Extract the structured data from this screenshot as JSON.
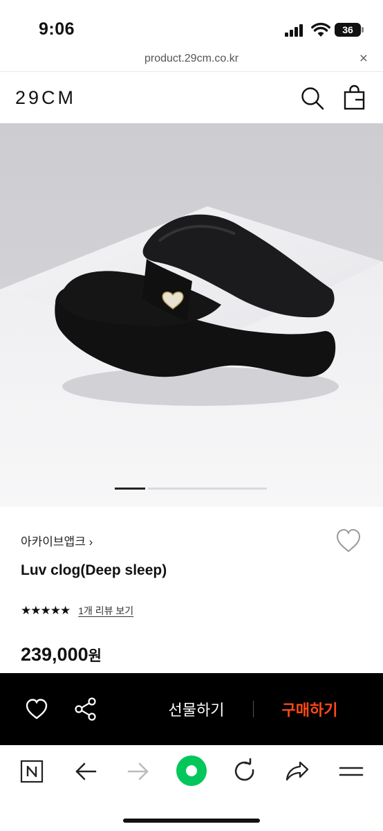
{
  "status_bar": {
    "time": "9:06",
    "battery": "36"
  },
  "url_bar": {
    "url": "product.29cm.co.kr",
    "close": "×"
  },
  "header": {
    "logo": "29CM"
  },
  "product": {
    "brand": "아카이브앱크 ›",
    "name": "Luv clog(Deep sleep)",
    "stars": "★★★★★",
    "rating": 5,
    "review_link": "1개 리뷰 보기",
    "price": "239,000",
    "price_unit": "원"
  },
  "carousel": {
    "current": 1
  },
  "action_bar": {
    "gift_label": "선물하기",
    "buy_label": "구매하기"
  },
  "colors": {
    "accent": "#ff4a17",
    "action_bar_bg": "#000000",
    "naver_green": "#03c75a"
  },
  "icons": [
    "search-icon",
    "bag-icon",
    "heart-icon",
    "share-icon",
    "naver-n-icon",
    "back-arrow-icon",
    "forward-arrow-icon",
    "naver-green-dot-icon",
    "reload-icon",
    "share-arrow-icon",
    "menu-icon"
  ]
}
